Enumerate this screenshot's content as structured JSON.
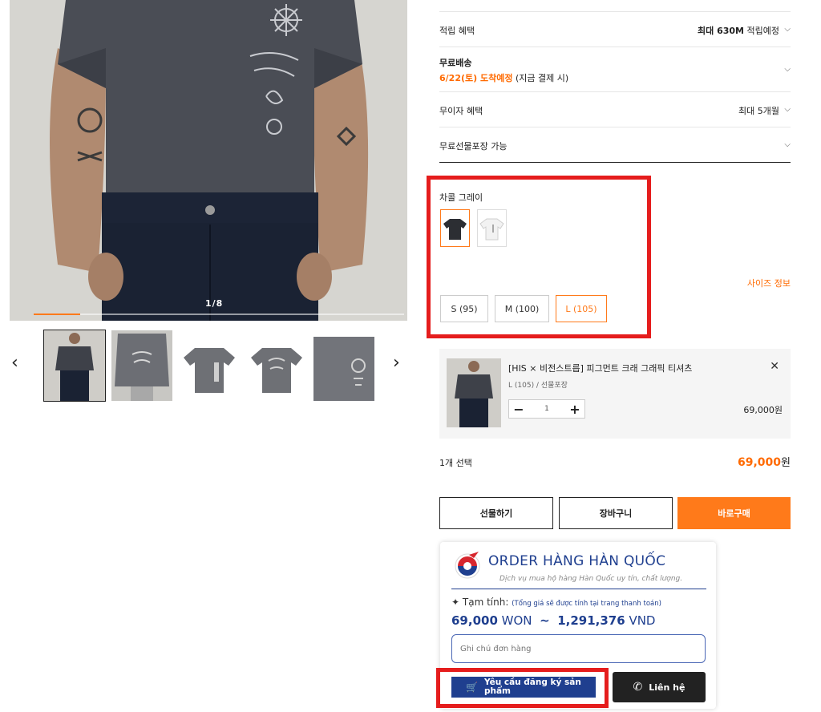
{
  "gallery": {
    "counter": "1/8",
    "progress": 0.125,
    "prev_arrow": "‹",
    "next_arrow": "›"
  },
  "benefits": [
    {
      "label": "적립 혜택",
      "value_bold": "최대 630M",
      "value_rest": " 적립예정"
    },
    {
      "label": "무료배송",
      "note_highlight": "6/22(토) 도착예정",
      "note_rest": " (지금 결제 시)"
    },
    {
      "label": "무이자 혜택",
      "value": "최대 5개월"
    },
    {
      "label": "무료선물포장 가능"
    }
  ],
  "options": {
    "color_label": "차콜 그레이",
    "size_info": "사이즈 정보",
    "sizes": [
      "S (95)",
      "M (100)",
      "L (105)"
    ],
    "selected_size": "L (105)"
  },
  "selected_item": {
    "name": "[HIS × 비전스트릅] 피그먼트 크래 그래픽 티셔츠",
    "option": "L (105) / 선물포장",
    "quantity": "1",
    "price": "69,000원",
    "minus": "−",
    "plus": "+",
    "close": "✕"
  },
  "summary": {
    "count": "1개 선택",
    "total_amount": "69,000",
    "total_unit": "원"
  },
  "actions": {
    "gift": "선물하기",
    "cart": "장바구니",
    "buy": "바로구매"
  },
  "order_widget": {
    "title": "ORDER HÀNG HÀN QUỐC",
    "subtitle": "Dịch vụ mua hộ hàng Hàn Quốc uy tín, chất lượng.",
    "estimate_label": "Tạm tính:",
    "estimate_note": "(Tổng giá sẽ được tính tại trang thanh toán)",
    "price_won": "69,000",
    "won_unit": "WON",
    "tilde": "~",
    "price_vnd": "1,291,376",
    "vnd_unit": "VND",
    "note_placeholder": "Ghi chú đơn hàng",
    "register_button": "Yêu cầu đăng ký sản phẩm",
    "contact_button": "Liên hệ"
  },
  "colors": {
    "accent": "#ff7a1a",
    "highlight_box": "#e51d1d",
    "brand_blue": "#1f3f8f"
  }
}
